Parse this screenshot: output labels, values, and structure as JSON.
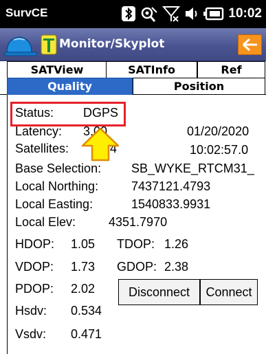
{
  "statusbar": {
    "app_name": "SurvCE",
    "time": "10:02"
  },
  "titlebar": {
    "title": "Monitor/Skyplot",
    "back_icon": "arrow-left-icon",
    "accent": "#f7941d"
  },
  "tabs": {
    "row1": [
      {
        "label": "SATView"
      },
      {
        "label": "SATInfo"
      },
      {
        "label": "Ref"
      }
    ],
    "row2": [
      {
        "label": "Quality",
        "active": true
      },
      {
        "label": "Position",
        "active": false
      }
    ]
  },
  "quality": {
    "status_label": "Status:",
    "status_value": "DGPS",
    "latency_label": "Latency:",
    "latency_value": "3.00",
    "satellites_label": "Satellites:",
    "satellites_value": "24",
    "date": "01/20/2020",
    "time": "10:02:57.0",
    "base_label": "Base Selection:",
    "base_value": "SB_WYKE_RTCM31_",
    "northing_label": "Local Northing:",
    "northing_value": "7437121.4793",
    "easting_label": "Local Easting:",
    "easting_value": "1540833.9931",
    "elev_label": "Local Elev:",
    "elev_value": "4351.7970",
    "hdop_label": "HDOP:",
    "hdop_value": "1.05",
    "tdop_label": "TDOP:",
    "tdop_value": "1.26",
    "vdop_label": "VDOP:",
    "vdop_value": "1.73",
    "gdop_label": "GDOP:",
    "gdop_value": "2.38",
    "pdop_label": "PDOP:",
    "pdop_value": "2.02",
    "hsdv_label": "Hsdv:",
    "hsdv_value": "0.534",
    "vsdv_label": "Vsdv:",
    "vsdv_value": "0.471"
  },
  "buttons": {
    "disconnect": "Disconnect",
    "connect": "Connect"
  },
  "annotations": {
    "highlight_color": "#e8202a",
    "arrow_color": "#ffee00"
  }
}
